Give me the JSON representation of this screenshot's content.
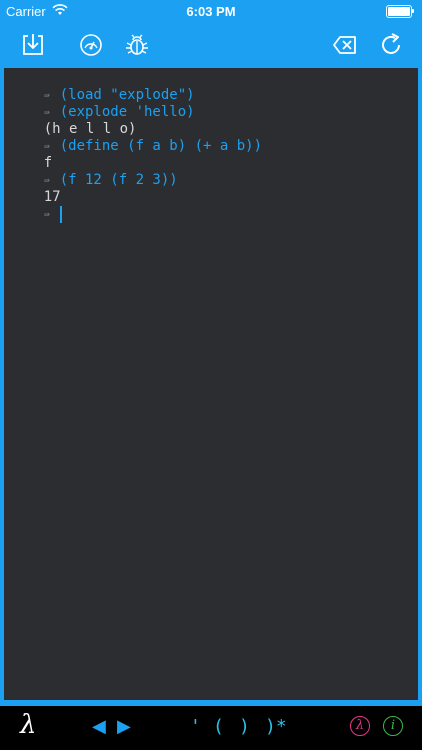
{
  "status_bar": {
    "carrier": "Carrier",
    "time": "6:03 PM"
  },
  "toolbar": {
    "left_icons": [
      "download-icon",
      "speedometer-icon",
      "bug-icon"
    ],
    "right_icons": [
      "clear-icon",
      "refresh-icon"
    ]
  },
  "console": {
    "prompt_glyph": "⇛",
    "lines": [
      {
        "type": "input",
        "text": "(load \"explode\")"
      },
      {
        "type": "input",
        "text": "(explode 'hello)"
      },
      {
        "type": "output",
        "text": "(h e l l o)"
      },
      {
        "type": "input",
        "text": "(define (f a b) (+ a b))"
      },
      {
        "type": "output",
        "text": "f"
      },
      {
        "type": "input",
        "text": "(f 12 (f 2 3))"
      },
      {
        "type": "output",
        "text": "17"
      },
      {
        "type": "input",
        "text": ""
      }
    ]
  },
  "bottom_bar": {
    "lambda": "λ",
    "left_arrow": "◀",
    "right_arrow": "▶",
    "quote": "'",
    "open_paren": "(",
    "close_paren": ")",
    "close_all": ")*",
    "lambda_badge": "λ",
    "info_badge": "i"
  },
  "colors": {
    "accent": "#1ba0f2",
    "console_bg": "#2b2d30",
    "input_text": "#1ba0f2",
    "output_text": "#d8d8d8",
    "lambda_badge": "#e8388c",
    "info_badge": "#3cb84a"
  }
}
